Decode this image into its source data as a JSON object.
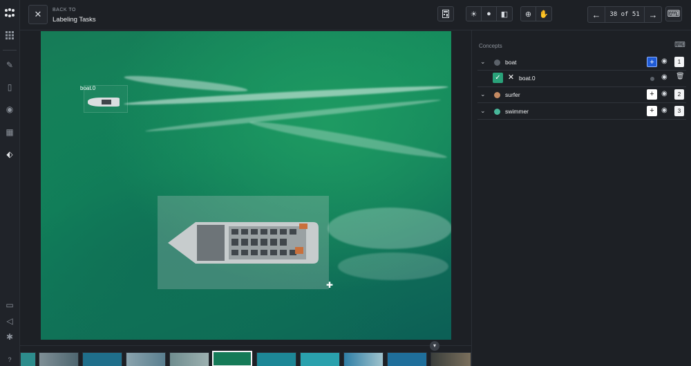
{
  "topbar": {
    "back_small": "BACK TO",
    "back_title": "Labeling Tasks",
    "pager_count": "38 of 51",
    "tool_icons": [
      "calculator-icon",
      "brightness-icon",
      "saturation-icon",
      "contrast-icon",
      "zoom-in-icon",
      "pan-hand-icon"
    ]
  },
  "canvas": {
    "labels": [
      "boat.0"
    ]
  },
  "panel": {
    "title": "Concepts",
    "concepts": [
      {
        "name": "boat",
        "color": "#5c626a",
        "shortcut": "1",
        "expanded": true
      },
      {
        "name": "surfer",
        "color": "#c48a62",
        "shortcut": "2",
        "expanded": false
      },
      {
        "name": "swimmer",
        "color": "#48b79a",
        "shortcut": "3",
        "expanded": false
      }
    ],
    "instance": {
      "name": "boat.0"
    }
  },
  "colors": {
    "accent": "#1f5bd6",
    "confirm": "#2aa27a"
  }
}
